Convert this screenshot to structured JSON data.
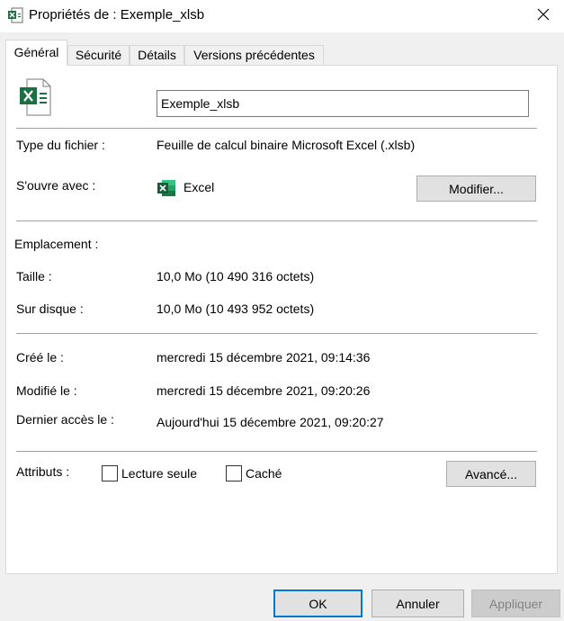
{
  "window": {
    "title": "Propriétés de : Exemple_xlsb"
  },
  "tabs": [
    {
      "label": "Général"
    },
    {
      "label": "Sécurité"
    },
    {
      "label": "Détails"
    },
    {
      "label": "Versions précédentes"
    }
  ],
  "file": {
    "name": "Exemple_xlsb",
    "icon": "excel-file-icon"
  },
  "info": {
    "type_label": "Type du fichier :",
    "type_value": "Feuille de calcul binaire Microsoft Excel (.xlsb)",
    "opens_label": "S'ouvre avec :",
    "opens_value": "Excel",
    "modify_button": "Modifier...",
    "location_label": "Emplacement :",
    "location_value": "",
    "size_label": "Taille :",
    "size_value": "10,0 Mo (10 490 316 octets)",
    "disk_label": "Sur disque :",
    "disk_value": "10,0 Mo (10 493 952 octets)",
    "created_label": "Créé le :",
    "created_value": "mercredi 15 décembre 2021, 09:14:36",
    "modified_label": "Modifié le :",
    "modified_value": "mercredi 15 décembre 2021, 09:20:26",
    "accessed_label": "Dernier accès le :",
    "accessed_value": "Aujourd'hui 15 décembre 2021, 09:20:27"
  },
  "attributes": {
    "label": "Attributs :",
    "readonly_label": "Lecture seule",
    "readonly_checked": false,
    "hidden_label": "Caché",
    "hidden_checked": false,
    "advanced_button": "Avancé..."
  },
  "footer": {
    "ok": "OK",
    "cancel": "Annuler",
    "apply": "Appliquer"
  },
  "colors": {
    "excel_green": "#1d6f42",
    "accent": "#0078d7"
  }
}
